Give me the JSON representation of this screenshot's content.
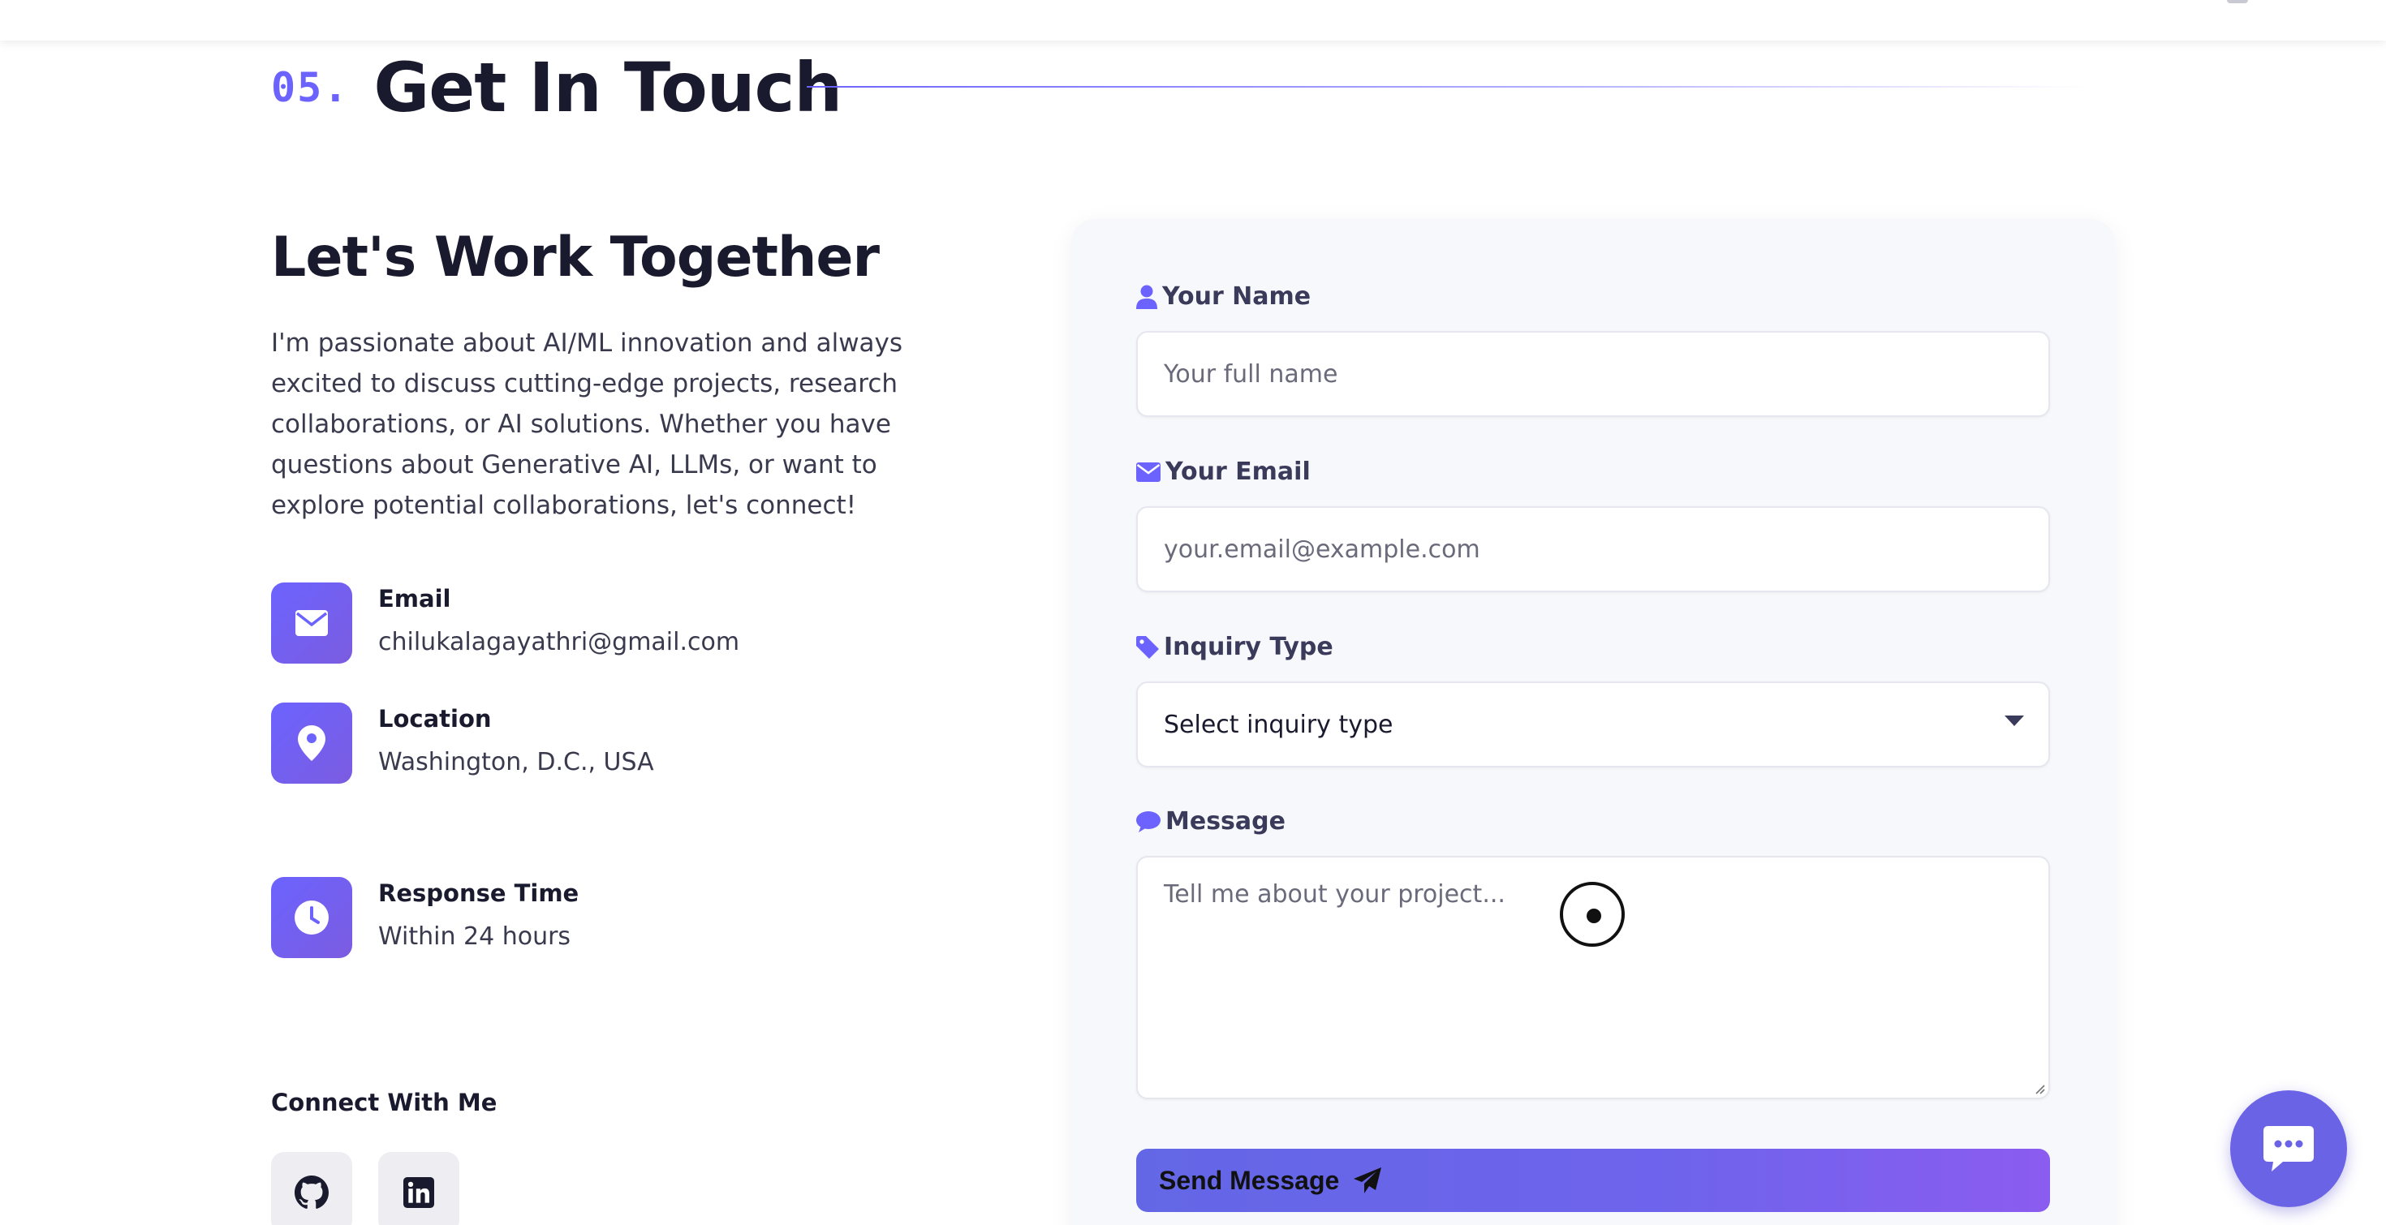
{
  "section": {
    "number": "05.",
    "title": "Get In Touch"
  },
  "left": {
    "heading": "Let's Work Together",
    "intro": "I'm passionate about AI/ML innovation and always excited to discuss cutting-edge projects, research collaborations, or AI solutions. Whether you have questions about Generative AI, LLMs, or want to explore potential collaborations, let's connect!",
    "contacts": [
      {
        "label": "Email",
        "value": "chilukalagayathri@gmail.com",
        "icon": "envelope-icon"
      },
      {
        "label": "Location",
        "value": "Washington, D.C., USA",
        "icon": "map-pin-icon"
      },
      {
        "label": "Response Time",
        "value": "Within 24 hours",
        "icon": "clock-icon"
      }
    ],
    "connect_heading": "Connect With Me",
    "socials": [
      "github-icon",
      "linkedin-icon"
    ]
  },
  "form": {
    "name": {
      "label": "Your Name",
      "placeholder": "Your full name"
    },
    "email": {
      "label": "Your Email",
      "placeholder": "your.email@example.com"
    },
    "inquiry": {
      "label": "Inquiry Type",
      "selected": "Select inquiry type"
    },
    "message": {
      "label": "Message",
      "placeholder": "Tell me about your project..."
    },
    "submit_label": "Send Message"
  },
  "colors": {
    "accent": "#6c63ff",
    "heading": "#1a1a2e",
    "card_bg": "#f7f8fb"
  }
}
